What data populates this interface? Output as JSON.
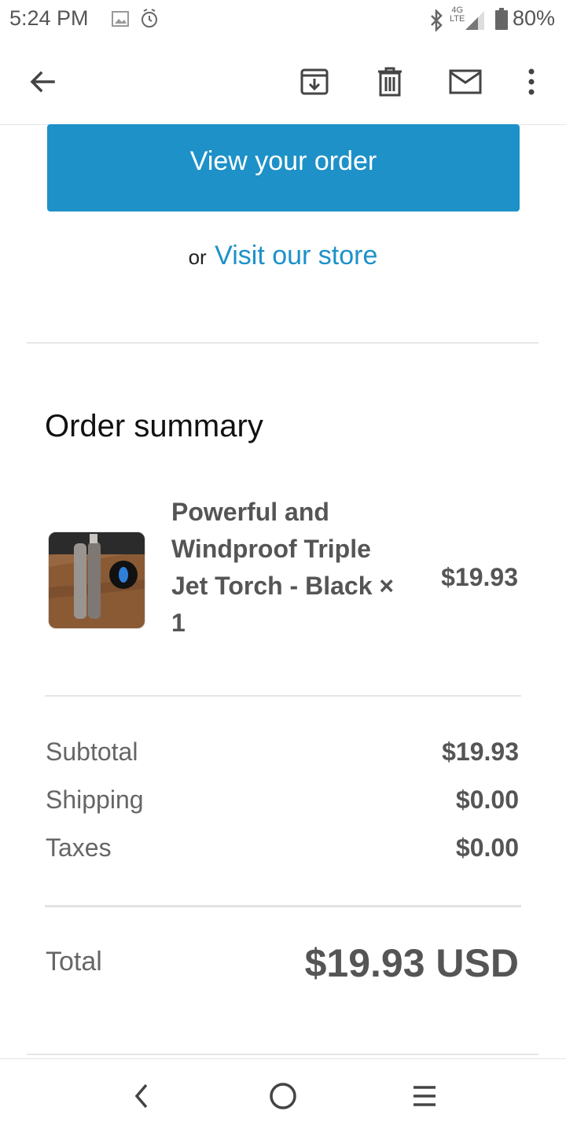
{
  "status_bar": {
    "time": "5:24 PM",
    "network_label": "4G\nLTE",
    "battery": "80%",
    "icons": [
      "image-icon",
      "alarm-icon",
      "bluetooth-icon",
      "signal-icon",
      "battery-icon"
    ]
  },
  "toolbar": {
    "icons": [
      "back-arrow-icon",
      "archive-icon",
      "delete-icon",
      "mail-icon",
      "more-vert-icon"
    ]
  },
  "email": {
    "view_order_label": "View your order",
    "visit_prefix": "or",
    "visit_link": "Visit our store",
    "order_summary_title": "Order summary",
    "product": {
      "name": "Powerful and Windproof Triple Jet Torch - Black × 1",
      "price": "$19.93"
    },
    "costs": [
      {
        "label": "Subtotal",
        "value": "$19.93"
      },
      {
        "label": "Shipping",
        "value": "$0.00"
      },
      {
        "label": "Taxes",
        "value": "$0.00"
      }
    ],
    "total_label": "Total",
    "total_value": "$19.93 USD"
  },
  "nav_bar": {
    "icons": [
      "back-chevron-icon",
      "home-circle-icon",
      "recents-icon"
    ]
  },
  "colors": {
    "accent": "#1d91c8",
    "text_dark": "#222222",
    "text_muted": "#666666"
  }
}
